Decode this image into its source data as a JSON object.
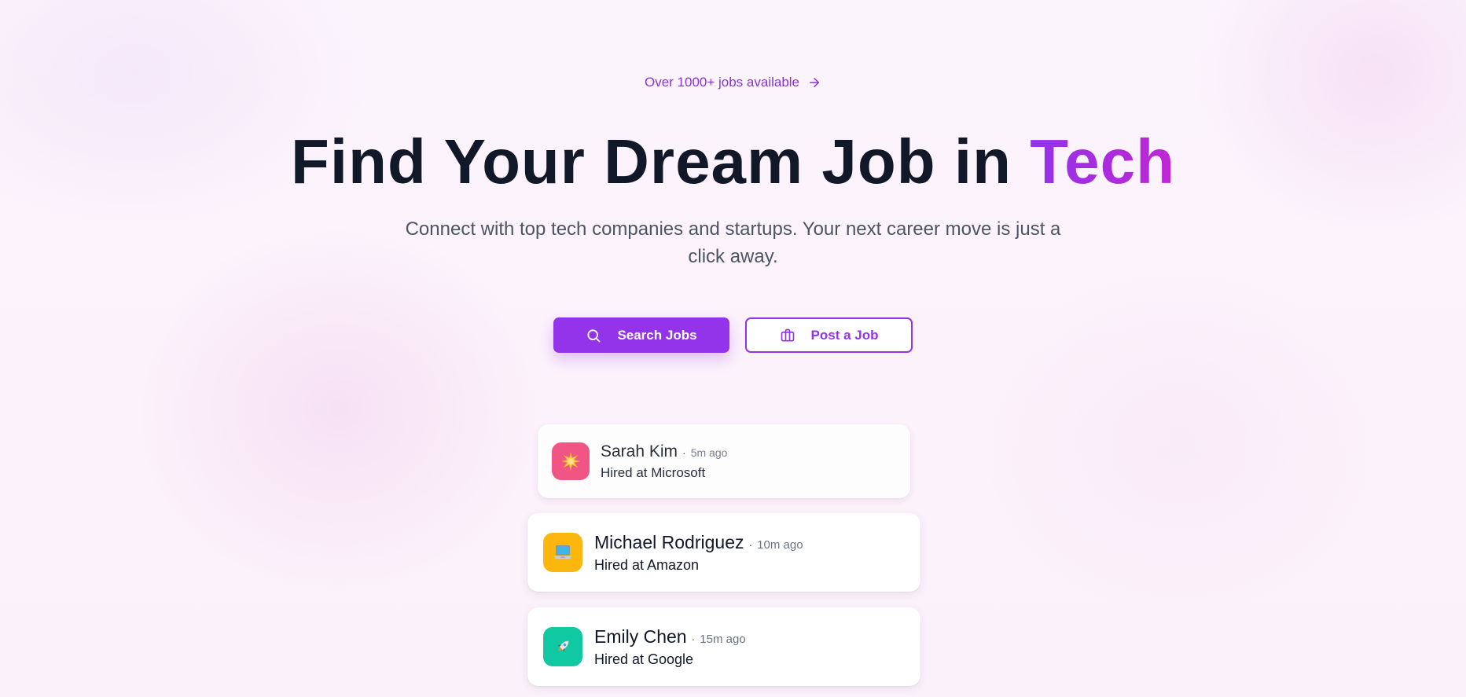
{
  "announcement": {
    "text": "Over 1000+ jobs available",
    "icon": "arrow-right-icon"
  },
  "hero": {
    "title_main": "Find Your Dream Job in ",
    "title_accent": "Tech",
    "subtitle": "Connect with top tech companies and startups. Your next career move is just a click away."
  },
  "actions": {
    "search_label": "Search Jobs",
    "search_icon": "search-icon",
    "post_label": "Post a Job",
    "post_icon": "briefcase-icon"
  },
  "colors": {
    "accent": "#9333ea",
    "accent_gradient_end": "#c026d3",
    "heading": "#111827",
    "body_text": "#4b5563"
  },
  "activity": [
    {
      "name": "Sarah Kim",
      "separator": "·",
      "time": "5m ago",
      "company_text": "Hired at Microsoft",
      "avatar_icon": "sparkle-emoji-icon",
      "avatar_color": "#f0457a"
    },
    {
      "name": "Michael Rodriguez",
      "separator": "·",
      "time": "10m ago",
      "company_text": "Hired at Amazon",
      "avatar_icon": "laptop-emoji-icon",
      "avatar_color": "#fbb70e"
    },
    {
      "name": "Emily Chen",
      "separator": "·",
      "time": "15m ago",
      "company_text": "Hired at Google",
      "avatar_icon": "rocket-emoji-icon",
      "avatar_color": "#10c8a2"
    }
  ]
}
